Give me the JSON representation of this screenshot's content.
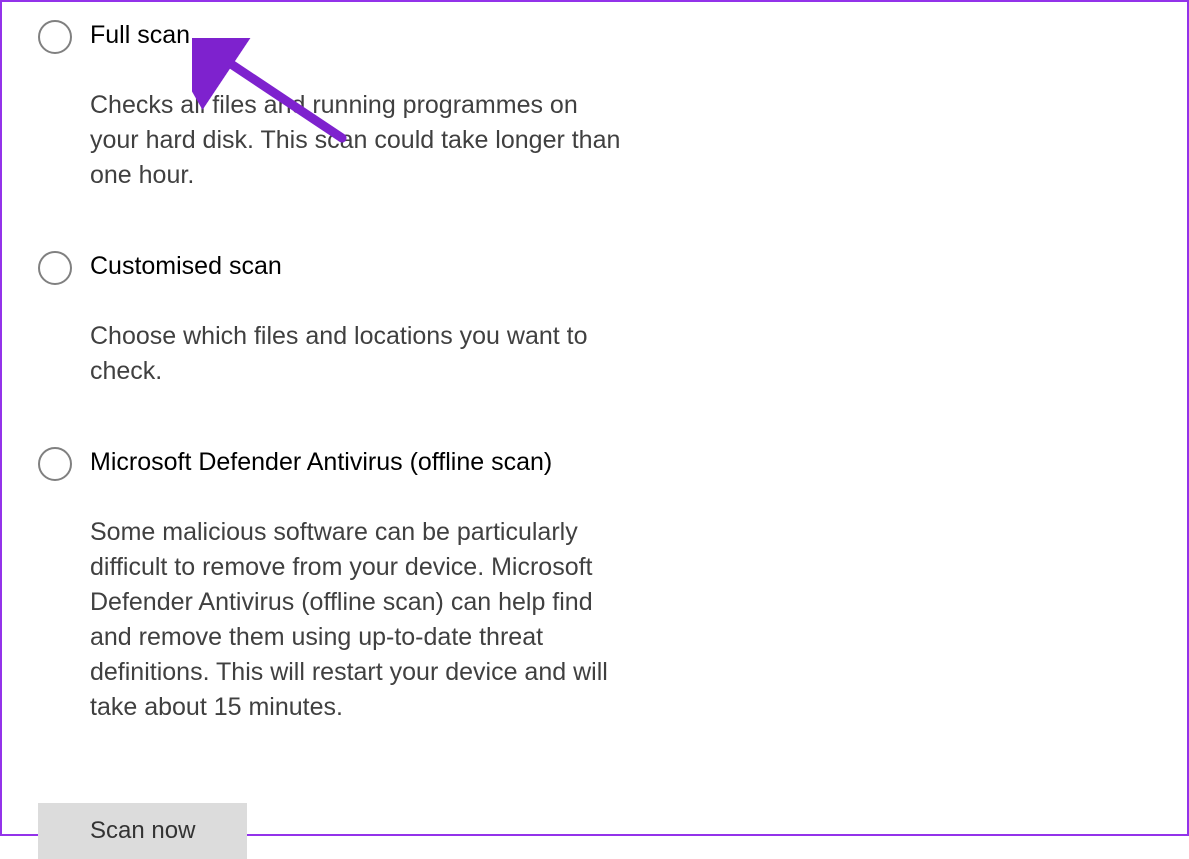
{
  "scan_options": [
    {
      "id": "full-scan",
      "title": "Full scan",
      "description": "Checks all files and running programmes on your hard disk. This scan could take longer than one hour."
    },
    {
      "id": "customised-scan",
      "title": "Customised scan",
      "description": "Choose which files and locations you want to check."
    },
    {
      "id": "offline-scan",
      "title": "Microsoft Defender Antivirus (offline scan)",
      "description": "Some malicious software can be particularly difficult to remove from your device. Microsoft Defender Antivirus (offline scan) can help find and remove them using up-to-date threat definitions. This will restart your device and will take about 15 minutes."
    }
  ],
  "button": {
    "scan_now": "Scan now"
  },
  "annotation": {
    "arrow_color": "#7e22ce"
  }
}
